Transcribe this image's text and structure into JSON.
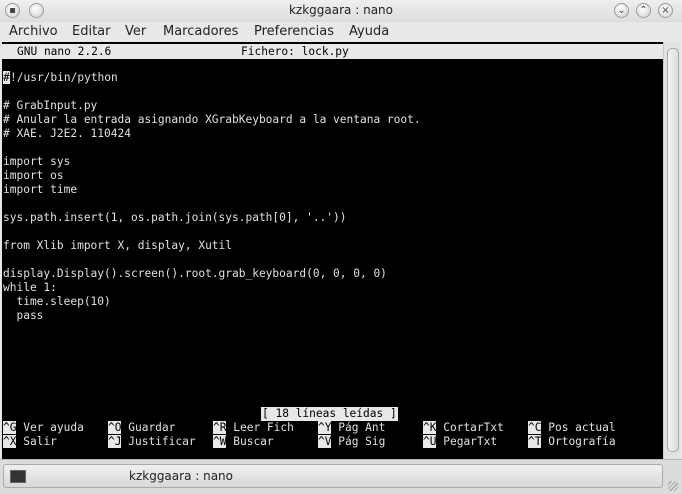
{
  "window": {
    "title": "kzkggaara : nano",
    "menu": [
      "Archivo",
      "Editar",
      "Ver",
      "Marcadores",
      "Preferencias",
      "Ayuda"
    ]
  },
  "nano": {
    "version": "GNU nano 2.2.6",
    "file": "Fichero: lock.py",
    "lines": [
      "!/usr/bin/python",
      "",
      "# GrabInput.py",
      "# Anular la entrada asignando XGrabKeyboard a la ventana root.",
      "# XAE. J2E2. 110424",
      "",
      "import sys",
      "import os",
      "import time",
      "",
      "sys.path.insert(1, os.path.join(sys.path[0], '..'))",
      "",
      "from Xlib import X, display, Xutil",
      "",
      "display.Display().screen().root.grab_keyboard(0, 0, 0, 0)",
      "while 1:",
      "  time.sleep(10)",
      "  pass"
    ],
    "caret_char": "#",
    "status": "[ 18 líneas leídas ]",
    "shortcuts_row1": [
      {
        "key": "^G",
        "label": "Ver ayuda"
      },
      {
        "key": "^O",
        "label": "Guardar"
      },
      {
        "key": "^R",
        "label": "Leer Fich"
      },
      {
        "key": "^Y",
        "label": "Pág Ant"
      },
      {
        "key": "^K",
        "label": "CortarTxt"
      },
      {
        "key": "^C",
        "label": "Pos actual"
      }
    ],
    "shortcuts_row2": [
      {
        "key": "^X",
        "label": "Salir"
      },
      {
        "key": "^J",
        "label": "Justificar"
      },
      {
        "key": "^W",
        "label": "Buscar"
      },
      {
        "key": "^V",
        "label": "Pág Sig"
      },
      {
        "key": "^U",
        "label": "PegarTxt"
      },
      {
        "key": "^T",
        "label": "Ortografía"
      }
    ]
  },
  "taskbar": {
    "item_label": "kzkggaara : nano"
  },
  "icons": [
    "terminal-icon",
    "pin-icon",
    "minimize-icon",
    "maximize-icon",
    "close-icon",
    "mouse-cursor-icon"
  ]
}
